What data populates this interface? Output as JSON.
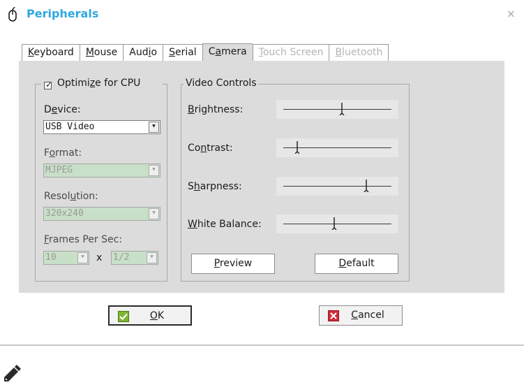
{
  "window": {
    "title": "Peripherals",
    "close": "×"
  },
  "tabs": [
    {
      "pre": "",
      "key": "K",
      "post": "eyboard",
      "state": "normal"
    },
    {
      "pre": "",
      "key": "M",
      "post": "ouse",
      "state": "normal"
    },
    {
      "pre": "Aud",
      "key": "i",
      "post": "o",
      "state": "normal"
    },
    {
      "pre": "",
      "key": "S",
      "post": "erial",
      "state": "normal"
    },
    {
      "pre": "C",
      "key": "a",
      "post": "mera",
      "state": "active"
    },
    {
      "pre": "",
      "key": "T",
      "post": "ouch Screen",
      "state": "disabled"
    },
    {
      "pre": "",
      "key": "B",
      "post": "luetooth",
      "state": "disabled"
    }
  ],
  "camera": {
    "optimize": {
      "pre": "Optimi",
      "key": "z",
      "post": "e for CPU",
      "checked": true,
      "mark": "✓"
    },
    "device": {
      "pre": "D",
      "key": "e",
      "post": "vice:",
      "value": "USB Video"
    },
    "format": {
      "pre": "F",
      "key": "o",
      "post": "rmat:",
      "value": "MJPEG"
    },
    "resolution": {
      "pre": "Resol",
      "key": "u",
      "post": "tion:",
      "value": "320x240"
    },
    "frames": {
      "pre": "",
      "key": "F",
      "post": "rames Per Sec:",
      "value1": "10",
      "separator": "x",
      "value2": "1/2"
    },
    "combo_arrow": "⯆"
  },
  "video_controls": {
    "legend": "Video Controls",
    "brightness": {
      "pre": "",
      "key": "B",
      "post": "rightness:",
      "level": 0.54
    },
    "contrast": {
      "pre": "Co",
      "key": "n",
      "post": "trast:",
      "level": 0.13
    },
    "sharpness": {
      "pre": "S",
      "key": "h",
      "post": "arpness:",
      "level": 0.77
    },
    "white_balance": {
      "pre": "",
      "key": "W",
      "post": "hite Balance:",
      "level": 0.47
    },
    "preview": {
      "pre": "",
      "key": "P",
      "post": "review"
    },
    "default": {
      "pre": "",
      "key": "D",
      "post": "efault"
    }
  },
  "footer": {
    "ok": {
      "pre": "",
      "key": "O",
      "post": "K"
    },
    "cancel": {
      "pre": "",
      "key": "C",
      "post": "ancel"
    }
  },
  "colors": {
    "title": "#2fa8e0",
    "disabled_field": "#c8e0c8",
    "panel": "#dcdcdc",
    "ok_icon": "#7fb530",
    "cancel_icon": "#d22b3a"
  },
  "icons": {
    "title": "mouse-icon",
    "ok": "check-icon",
    "cancel": "x-icon",
    "note": "pencil-note-icon"
  }
}
